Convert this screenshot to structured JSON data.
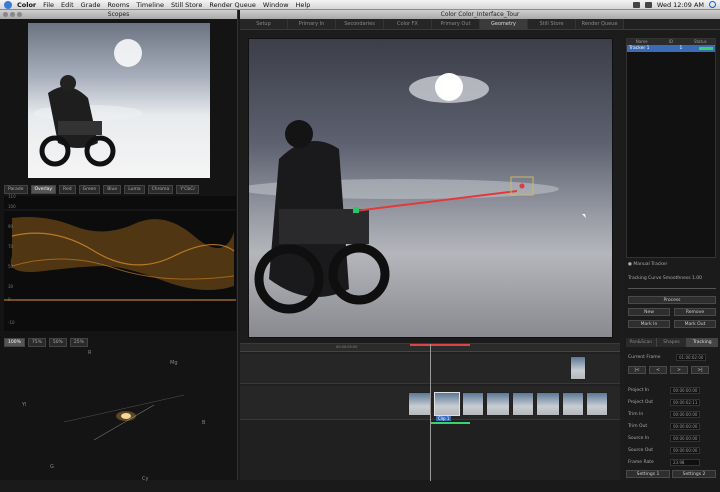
{
  "menubar": {
    "items": [
      "Color",
      "File",
      "Edit",
      "Grade",
      "Rooms",
      "Timeline",
      "Still Store",
      "Render Queue",
      "Window",
      "Help"
    ],
    "clock": "Wed 12:09 AM"
  },
  "scopes": {
    "title": "Scopes",
    "tabs": [
      "Parade",
      "Overlay",
      "Red",
      "Green",
      "Blue",
      "Luma",
      "Chroma",
      "Y'CbCr"
    ],
    "active_tab": "Overlay",
    "waveform_labels": [
      "110",
      "100",
      "90",
      "80",
      "70",
      "60",
      "50",
      "40",
      "30",
      "20",
      "10",
      "0",
      "-10"
    ],
    "pct_tabs": [
      "100%",
      "75%",
      "50%",
      "25%"
    ],
    "vector_labels": [
      "R",
      "Mg",
      "B",
      "Cy",
      "G",
      "Yl"
    ]
  },
  "main": {
    "title": "Color Color_Interface_Tour",
    "tabs": [
      "Setup",
      "Primary In",
      "Secondaries",
      "Color FX",
      "Primary Out",
      "Geometry",
      "Still Store",
      "Render Queue"
    ],
    "active_tab": "Geometry"
  },
  "tracker": {
    "headers": [
      "Name",
      "ID",
      "Status"
    ],
    "rows": [
      {
        "name": "Tracker 1",
        "id": "1"
      }
    ],
    "manual_label": "Manual Tracker",
    "curve_label": "Tracking Curve Smoothness",
    "curve_value": "1.00",
    "buttons": {
      "process": "Process",
      "new": "New",
      "remove": "Remove",
      "mark_in": "Mark In",
      "mark_out": "Mark Out"
    },
    "panel_tabs": [
      "Pan&Scan",
      "Shapes",
      "Tracking"
    ],
    "active_panel_tab": "Tracking",
    "current_frame_label": "Current Frame",
    "current_frame_value": "01:00:02:00",
    "fields": [
      {
        "label": "Project In",
        "value": "00:00:00:00"
      },
      {
        "label": "Project Out",
        "value": "00:00:02:11"
      },
      {
        "label": "Trim In",
        "value": "00:00:00:00"
      },
      {
        "label": "Trim Out",
        "value": "00:00:00:00"
      },
      {
        "label": "Source In",
        "value": "00:00:00:00"
      },
      {
        "label": "Source Out",
        "value": "00:00:00:00"
      }
    ],
    "frame_rate_label": "Frame Rate",
    "frame_rate_value": "23.98",
    "settings_1": "Settings 1",
    "settings_2": "Settings 2"
  },
  "timeline": {
    "timecode": "00:00:05:00",
    "clip_label": "Clip 1"
  }
}
